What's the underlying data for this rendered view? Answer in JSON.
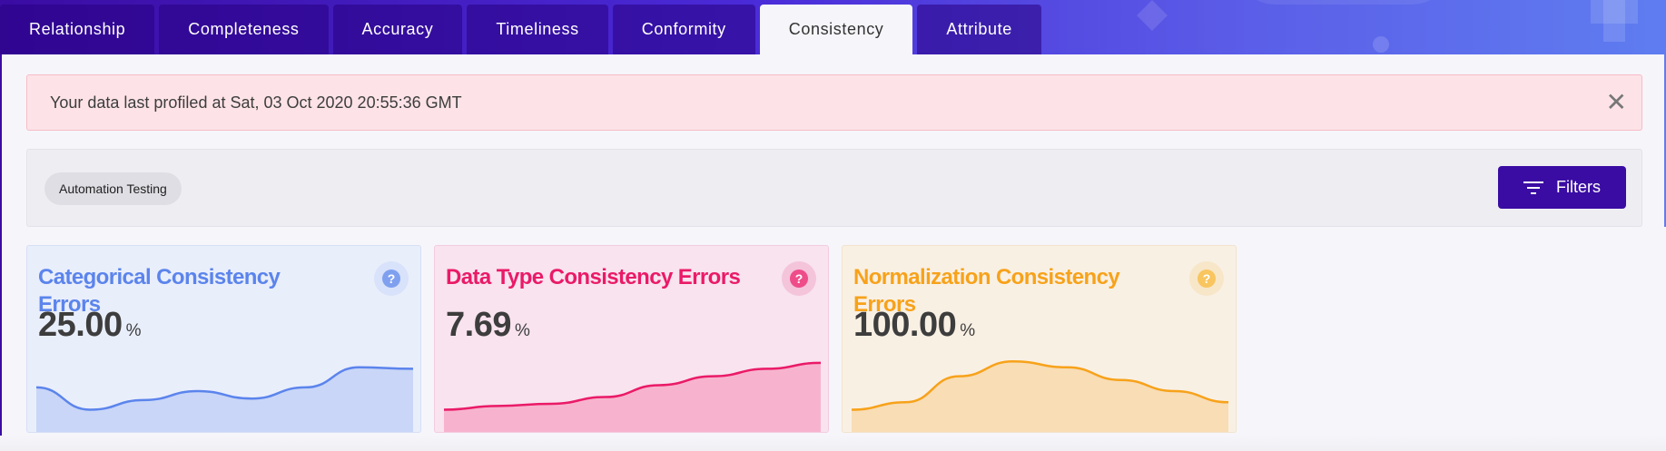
{
  "tabs": [
    {
      "label": "Relationship",
      "active": false
    },
    {
      "label": "Completeness",
      "active": false
    },
    {
      "label": "Accuracy",
      "active": false
    },
    {
      "label": "Timeliness",
      "active": false
    },
    {
      "label": "Conformity",
      "active": false
    },
    {
      "label": "Consistency",
      "active": true
    },
    {
      "label": "Attribute",
      "active": false
    }
  ],
  "alert": {
    "message": "Your data last profiled at Sat, 03 Oct 2020 20:55:36 GMT",
    "close_icon": "close-icon"
  },
  "filterbar": {
    "chip_label": "Automation Testing",
    "filters_label": "Filters",
    "filters_icon": "filter-icon"
  },
  "cards": [
    {
      "title": "Categorical Consistency Errors",
      "value": "25.00",
      "unit": "%",
      "color": "#5b84ec",
      "fill": "#c9d6f7",
      "trend": [
        0.55,
        0.25,
        0.38,
        0.5,
        0.4,
        0.55,
        0.82,
        0.8
      ]
    },
    {
      "title": "Data Type Consistency Errors",
      "value": "7.69",
      "unit": "%",
      "color": "#ea1a68",
      "fill": "#f7b3cd",
      "trend": [
        0.25,
        0.3,
        0.33,
        0.42,
        0.58,
        0.7,
        0.8,
        0.88
      ]
    },
    {
      "title": "Normalization Consistency Errors",
      "value": "100.00",
      "unit": "%",
      "color": "#f7a21a",
      "fill": "#f8ddb5",
      "trend": [
        0.25,
        0.35,
        0.7,
        0.9,
        0.82,
        0.65,
        0.5,
        0.35
      ]
    }
  ],
  "colors": {
    "brand": "#3a0ca3",
    "alert_bg": "#fde3e7"
  }
}
